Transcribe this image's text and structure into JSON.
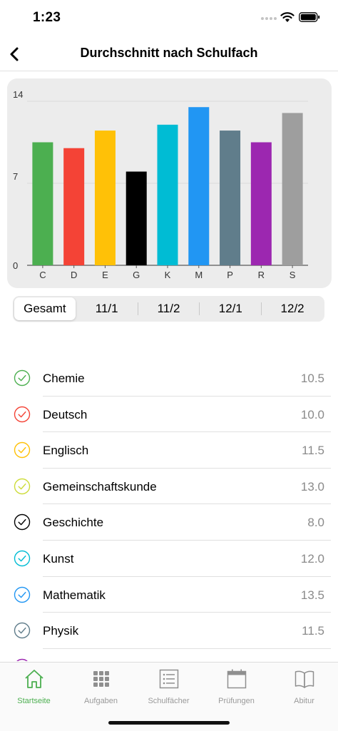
{
  "status_bar": {
    "time": "1:23"
  },
  "nav": {
    "title": "Durchschnitt nach Schulfach",
    "back_icon": "chevron-left-icon"
  },
  "chart_data": {
    "type": "bar",
    "categories": [
      "C",
      "D",
      "E",
      "G",
      "K",
      "M",
      "P",
      "R",
      "S"
    ],
    "values": [
      10.5,
      10.0,
      11.5,
      8.0,
      12.0,
      13.5,
      11.5,
      10.5,
      13.0
    ],
    "colors": [
      "#4caf50",
      "#f44336",
      "#ffc107",
      "#000000",
      "#00bcd4",
      "#2196f3",
      "#607d8b",
      "#9c27b0",
      "#9e9e9e"
    ],
    "ytick_labels": [
      "0",
      "7",
      "14"
    ],
    "yticks": [
      0,
      7,
      14
    ],
    "ylim": [
      0,
      14
    ],
    "grid": true
  },
  "segments": {
    "items": [
      "Gesamt",
      "11/1",
      "11/2",
      "12/1",
      "12/2"
    ],
    "selected": "Gesamt"
  },
  "subjects": [
    {
      "name": "Chemie",
      "value": "10.5",
      "color": "#4caf50"
    },
    {
      "name": "Deutsch",
      "value": "10.0",
      "color": "#f44336"
    },
    {
      "name": "Englisch",
      "value": "11.5",
      "color": "#ffc107"
    },
    {
      "name": "Gemeinschaftskunde",
      "value": "13.0",
      "color": "#cddc39"
    },
    {
      "name": "Geschichte",
      "value": "8.0",
      "color": "#000000"
    },
    {
      "name": "Kunst",
      "value": "12.0",
      "color": "#00bcd4"
    },
    {
      "name": "Mathematik",
      "value": "13.5",
      "color": "#2196f3"
    },
    {
      "name": "Physik",
      "value": "11.5",
      "color": "#607d8b"
    },
    {
      "name": "",
      "value": "",
      "color": "#9c27b0"
    }
  ],
  "tabs": [
    {
      "label": "Startseite",
      "icon": "home-icon",
      "active": true
    },
    {
      "label": "Aufgaben",
      "icon": "grid-icon",
      "active": false
    },
    {
      "label": "Schulfächer",
      "icon": "list-icon",
      "active": false
    },
    {
      "label": "Prüfungen",
      "icon": "calendar-icon",
      "active": false
    },
    {
      "label": "Abitur",
      "icon": "book-icon",
      "active": false
    }
  ],
  "colors": {
    "accent": "#4caf50",
    "inactive_tab": "#9a9a9a"
  }
}
